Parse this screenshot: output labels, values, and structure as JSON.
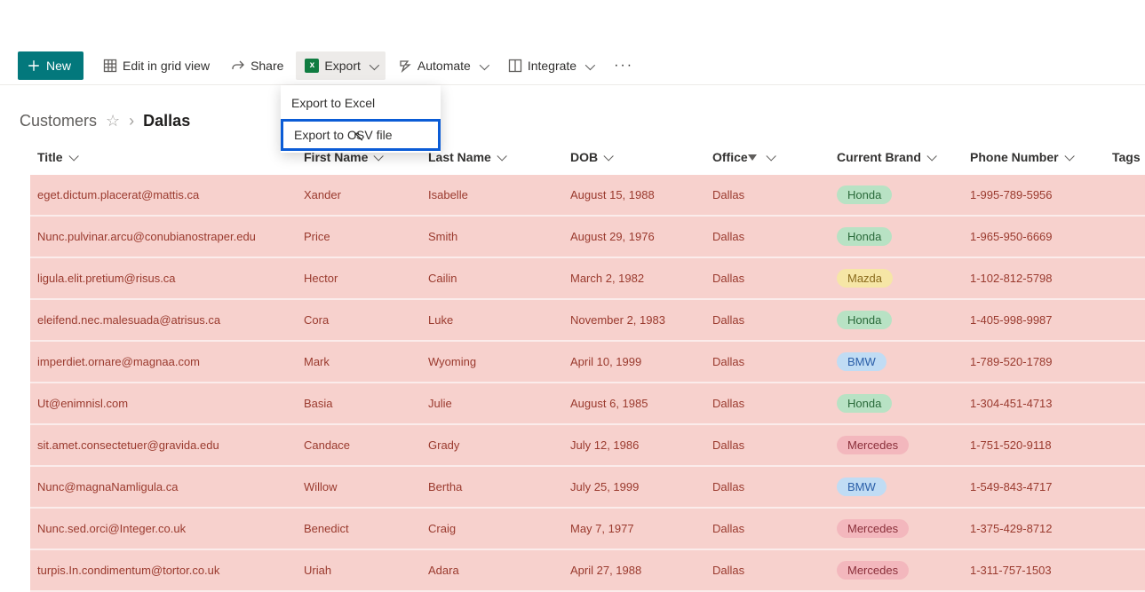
{
  "toolbar": {
    "new_label": "New",
    "edit_label": "Edit in grid view",
    "share_label": "Share",
    "export_label": "Export",
    "automate_label": "Automate",
    "integrate_label": "Integrate"
  },
  "export_menu": {
    "excel": "Export to Excel",
    "csv": "Export to CSV file"
  },
  "breadcrumb": {
    "list": "Customers",
    "view": "Dallas"
  },
  "columns": {
    "title": "Title",
    "first_name": "First Name",
    "last_name": "Last Name",
    "dob": "DOB",
    "office": "Office",
    "brand": "Current Brand",
    "phone": "Phone Number",
    "tags": "Tags"
  },
  "brand_colors": {
    "Honda": "pill-green",
    "Mazda": "pill-yellow",
    "BMW": "pill-blue",
    "Mercedes": "pill-pink"
  },
  "rows": [
    {
      "title": "eget.dictum.placerat@mattis.ca",
      "first": "Xander",
      "last": "Isabelle",
      "dob": "August 15, 1988",
      "office": "Dallas",
      "brand": "Honda",
      "phone": "1-995-789-5956"
    },
    {
      "title": "Nunc.pulvinar.arcu@conubianostraper.edu",
      "first": "Price",
      "last": "Smith",
      "dob": "August 29, 1976",
      "office": "Dallas",
      "brand": "Honda",
      "phone": "1-965-950-6669"
    },
    {
      "title": "ligula.elit.pretium@risus.ca",
      "first": "Hector",
      "last": "Cailin",
      "dob": "March 2, 1982",
      "office": "Dallas",
      "brand": "Mazda",
      "phone": "1-102-812-5798"
    },
    {
      "title": "eleifend.nec.malesuada@atrisus.ca",
      "first": "Cora",
      "last": "Luke",
      "dob": "November 2, 1983",
      "office": "Dallas",
      "brand": "Honda",
      "phone": "1-405-998-9987"
    },
    {
      "title": "imperdiet.ornare@magnaa.com",
      "first": "Mark",
      "last": "Wyoming",
      "dob": "April 10, 1999",
      "office": "Dallas",
      "brand": "BMW",
      "phone": "1-789-520-1789"
    },
    {
      "title": "Ut@enimnisl.com",
      "first": "Basia",
      "last": "Julie",
      "dob": "August 6, 1985",
      "office": "Dallas",
      "brand": "Honda",
      "phone": "1-304-451-4713"
    },
    {
      "title": "sit.amet.consectetuer@gravida.edu",
      "first": "Candace",
      "last": "Grady",
      "dob": "July 12, 1986",
      "office": "Dallas",
      "brand": "Mercedes",
      "phone": "1-751-520-9118"
    },
    {
      "title": "Nunc@magnaNamligula.ca",
      "first": "Willow",
      "last": "Bertha",
      "dob": "July 25, 1999",
      "office": "Dallas",
      "brand": "BMW",
      "phone": "1-549-843-4717"
    },
    {
      "title": "Nunc.sed.orci@Integer.co.uk",
      "first": "Benedict",
      "last": "Craig",
      "dob": "May 7, 1977",
      "office": "Dallas",
      "brand": "Mercedes",
      "phone": "1-375-429-8712"
    },
    {
      "title": "turpis.In.condimentum@tortor.co.uk",
      "first": "Uriah",
      "last": "Adara",
      "dob": "April 27, 1988",
      "office": "Dallas",
      "brand": "Mercedes",
      "phone": "1-311-757-1503"
    }
  ]
}
